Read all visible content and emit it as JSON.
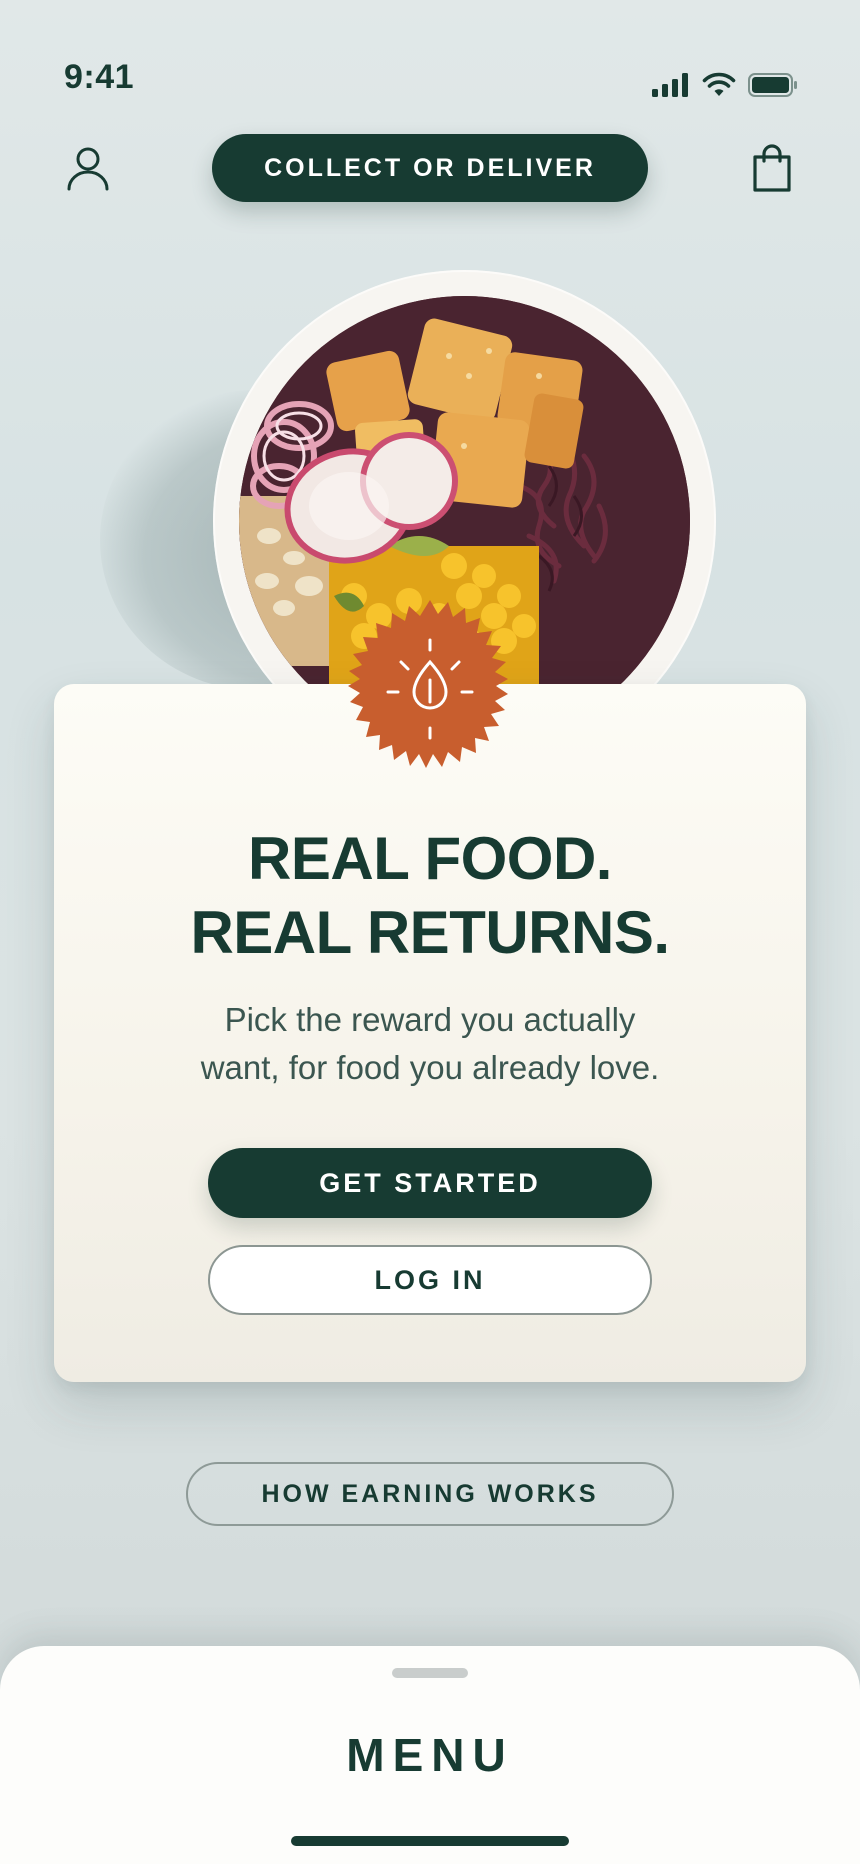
{
  "status_bar": {
    "time": "9:41",
    "icons": [
      "cellular-signal-icon",
      "wifi-icon",
      "battery-icon"
    ]
  },
  "top_nav": {
    "profile_icon": "person-icon",
    "fulfillment_button_label": "COLLECT OR DELIVER",
    "cart_icon": "shopping-bag-icon"
  },
  "hero": {
    "image": "poke-bowl-with-tofu-radish-corn-cabbage",
    "badge_icon": "seed-sun-icon"
  },
  "card": {
    "headline_line1": "REAL FOOD.",
    "headline_line2": "REAL RETURNS.",
    "subhead_line1": "Pick the reward you actually",
    "subhead_line2": "want, for food you already love.",
    "primary_button": "GET STARTED",
    "secondary_button": "LOG IN"
  },
  "how_earning_button": "HOW EARNING WORKS",
  "menu_sheet": {
    "title": "MENU"
  },
  "colors": {
    "brand_dark_green": "#173b32",
    "badge_orange": "#c85e2e",
    "card_cream": "#f6f3ea",
    "background": "#d9e2e3"
  }
}
